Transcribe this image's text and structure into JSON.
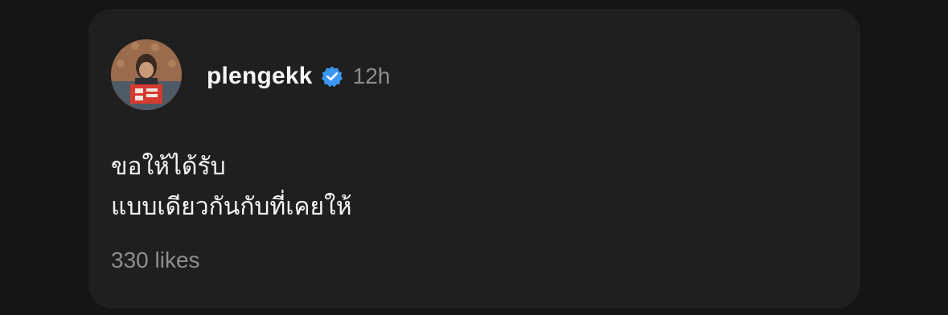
{
  "post": {
    "author": {
      "username": "plengekk",
      "avatar_icon": "profile-photo",
      "verified_icon": "verified-badge-icon",
      "verified_color": "#3b97f0"
    },
    "timestamp": "12h",
    "caption_lines": [
      "ขอให้ได้รับ",
      "แบบเดียวกันกับที่เคยให้"
    ],
    "likes": "330 likes"
  },
  "colors": {
    "background": "#151515",
    "card": "#1f1f1f",
    "primary_text": "#f5f5f5",
    "secondary_text": "#8e8e8e"
  }
}
